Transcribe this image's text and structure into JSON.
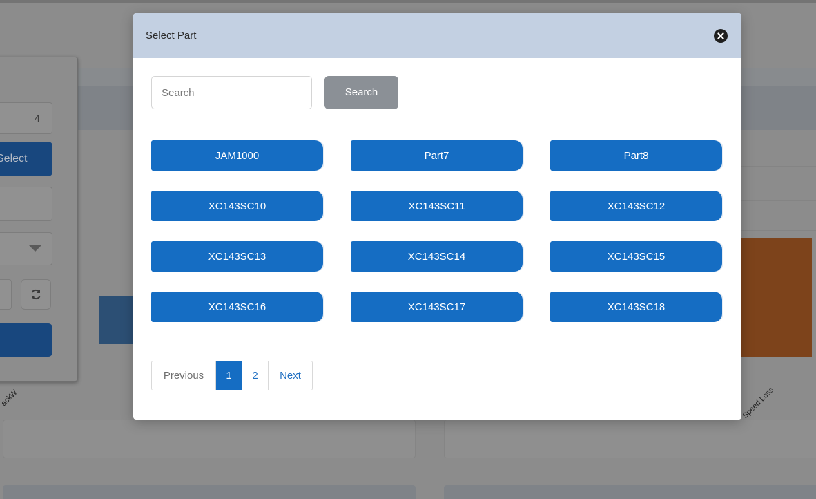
{
  "background": {
    "top_input_value": "⁦4",
    "select_button_label": "Select",
    "rotated_label_left": "ackW",
    "rotated_label_right": "Speed Loss"
  },
  "modal": {
    "title": "Select Part",
    "close_icon": "close-circle-icon",
    "search": {
      "placeholder": "Search",
      "value": "",
      "button_label": "Search"
    },
    "parts": [
      "JAM1000",
      "Part7",
      "Part8",
      "XC143SC10",
      "XC143SC11",
      "XC143SC12",
      "XC143SC13",
      "XC143SC14",
      "XC143SC15",
      "XC143SC16",
      "XC143SC17",
      "XC143SC18"
    ],
    "pagination": {
      "previous_label": "Previous",
      "pages": [
        "1",
        "2"
      ],
      "current_page": "1",
      "next_label": "Next"
    }
  },
  "colors": {
    "header_bg": "#c3d0e2",
    "part_button": "#156dc3",
    "search_button": "#8b9096",
    "overlay": "#8c8c8c"
  }
}
